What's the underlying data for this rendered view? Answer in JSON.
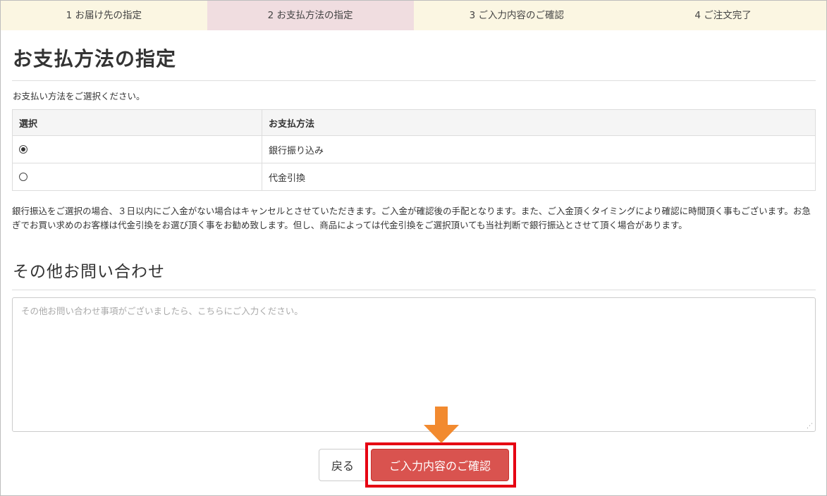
{
  "steps": [
    {
      "label": "1 お届け先の指定",
      "active": false
    },
    {
      "label": "2 お支払方法の指定",
      "active": true
    },
    {
      "label": "3 ご入力内容のご確認",
      "active": false
    },
    {
      "label": "4 ご注文完了",
      "active": false
    }
  ],
  "page_title": "お支払方法の指定",
  "intro_text": "お支払い方法をご選択ください。",
  "payment_table": {
    "headers": [
      "選択",
      "お支払方法"
    ],
    "rows": [
      {
        "selected": true,
        "method": "銀行振り込み"
      },
      {
        "selected": false,
        "method": "代金引換"
      }
    ]
  },
  "notice_text": "銀行振込をご選択の場合、３日以内にご入金がない場合はキャンセルとさせていただきます。ご入金が確認後の手配となります。また、ご入金頂くタイミングにより確認に時間頂く事もございます。お急ぎでお買い求めのお客様は代金引換をお選び頂く事をお勧め致します。但し、商品によっては代金引換をご選択頂いても当社判断で銀行振込とさせて頂く場合があります。",
  "inquiry": {
    "title": "その他お問い合わせ",
    "placeholder": "その他お問い合わせ事項がございましたら、こちらにご入力ください。",
    "value": ""
  },
  "buttons": {
    "back_label": "戻る",
    "confirm_label": "ご入力内容のご確認"
  },
  "colors": {
    "step_bg": "#fbf6e2",
    "step_active_bg": "#f0dde0",
    "confirm_button": "#d9534f",
    "highlight_border": "#e60012",
    "arrow": "#f28a2f"
  },
  "icons": {
    "annotation": "down-arrow-icon",
    "resize": "resize-grip-icon"
  }
}
